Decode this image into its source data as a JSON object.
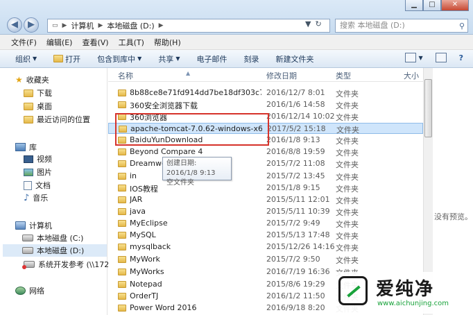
{
  "address": {
    "crumbs": [
      "计算机",
      "本地磁盘 (D:)"
    ]
  },
  "search": {
    "placeholder": "搜索 本地磁盘 (D:)"
  },
  "menu": [
    "文件(F)",
    "编辑(E)",
    "查看(V)",
    "工具(T)",
    "帮助(H)"
  ],
  "toolbar": {
    "organize": "组织",
    "open": "打开",
    "include": "包含到库中",
    "share": "共享",
    "email": "电子邮件",
    "burn": "刻录",
    "new_folder": "新建文件夹"
  },
  "sidebar": {
    "favorites": "收藏夹",
    "downloads": "下载",
    "desktop": "桌面",
    "recent": "最近访问的位置",
    "library": "库",
    "videos": "视频",
    "pictures": "图片",
    "documents": "文档",
    "music": "音乐",
    "computer": "计算机",
    "drive_c": "本地磁盘 (C:)",
    "drive_d": "本地磁盘 (D:)",
    "net_drive": "系统开发参考 (\\\\172.17",
    "network": "网络"
  },
  "columns": {
    "name": "名称",
    "date": "修改日期",
    "type": "类型",
    "size": "大小"
  },
  "files": [
    {
      "name": "8b88ce8e71fd914dd7be18df303c732b",
      "date": "2016/12/7 8:01",
      "type": "文件夹"
    },
    {
      "name": "360安全浏览器下载",
      "date": "2016/1/6 14:58",
      "type": "文件夹"
    },
    {
      "name": "360浏览器",
      "date": "2016/12/14 10:02",
      "type": "文件夹"
    },
    {
      "name": "apache-tomcat-7.0.62-windows-x64",
      "date": "2017/5/2 15:18",
      "type": "文件夹"
    },
    {
      "name": "BaiduYunDownload",
      "date": "2016/1/8 9:13",
      "type": "文件夹"
    },
    {
      "name": "Beyond Compare 4",
      "date": "2016/8/8 19:59",
      "type": "文件夹"
    },
    {
      "name": "Dreamwe",
      "date": "2015/7/2 11:08",
      "type": "文件夹"
    },
    {
      "name": "in",
      "date": "2015/7/2 13:45",
      "type": "文件夹"
    },
    {
      "name": "IOS教程",
      "date": "2015/1/8 9:15",
      "type": "文件夹"
    },
    {
      "name": "JAR",
      "date": "2015/5/11 12:01",
      "type": "文件夹"
    },
    {
      "name": "java",
      "date": "2015/5/11 10:39",
      "type": "文件夹"
    },
    {
      "name": "MyEclipse",
      "date": "2015/7/2 9:49",
      "type": "文件夹"
    },
    {
      "name": "MySQL",
      "date": "2015/5/13 17:48",
      "type": "文件夹"
    },
    {
      "name": "mysqlback",
      "date": "2015/12/26 14:16",
      "type": "文件夹"
    },
    {
      "name": "MyWork",
      "date": "2015/7/2 9:50",
      "type": "文件夹"
    },
    {
      "name": "MyWorks",
      "date": "2016/7/19 16:36",
      "type": "文件夹"
    },
    {
      "name": "Notepad",
      "date": "2015/8/6 19:29",
      "type": "文件夹"
    },
    {
      "name": "OrderTJ",
      "date": "2016/1/2 11:50",
      "type": "文件夹"
    },
    {
      "name": "Power Word 2016",
      "date": "2016/9/18 8:20",
      "type": "文件夹"
    }
  ],
  "tooltip": {
    "line1": "创建日期: 2016/1/8 9:13",
    "line2": "空文件夹"
  },
  "preview": {
    "text": "没有预览。"
  },
  "watermark": {
    "brand": "爱纯净",
    "url": "www.aichunjing.com"
  }
}
